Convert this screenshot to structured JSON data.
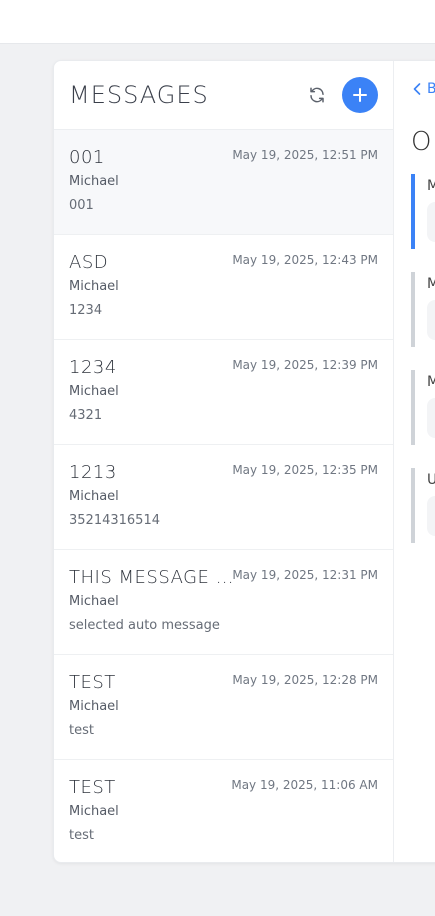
{
  "list": {
    "title": "MESSAGES",
    "items": [
      {
        "title": "001",
        "date": "May 19, 2025, 12:51 PM",
        "author": "Michael",
        "preview": "001"
      },
      {
        "title": "ASD",
        "date": "May 19, 2025, 12:43 PM",
        "author": "Michael",
        "preview": "1234"
      },
      {
        "title": "1234",
        "date": "May 19, 2025, 12:39 PM",
        "author": "Michael",
        "preview": "4321"
      },
      {
        "title": "1213",
        "date": "May 19, 2025, 12:35 PM",
        "author": "Michael",
        "preview": "35214316514"
      },
      {
        "title": "THIS MESSAGE ...",
        "date": "May 19, 2025, 12:31 PM",
        "author": "Michael",
        "preview": "selected auto message"
      },
      {
        "title": "TEST",
        "date": "May 19, 2025, 12:28 PM",
        "author": "Michael",
        "preview": "test"
      },
      {
        "title": "TEST",
        "date": "May 19, 2025, 11:06 AM",
        "author": "Michael",
        "preview": "test"
      }
    ]
  },
  "detail": {
    "back_label": "B",
    "title": "O",
    "fields": [
      {
        "label": "M"
      },
      {
        "label": "M"
      },
      {
        "label": "M"
      },
      {
        "label": "U"
      }
    ]
  },
  "icons": {
    "refresh": "refresh-icon",
    "add": "plus-icon",
    "back": "chevron-left-icon"
  },
  "colors": {
    "accent": "#3b82f6",
    "background": "#f0f1f3"
  }
}
